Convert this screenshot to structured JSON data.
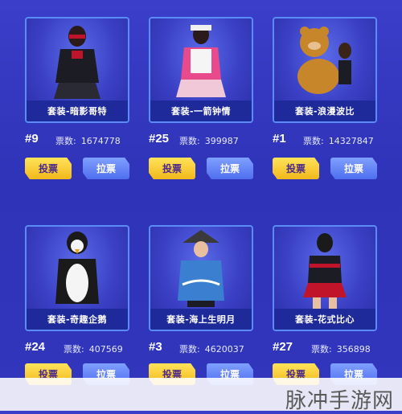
{
  "cards": [
    {
      "name": "套装-暗影哥特",
      "rank": "#9",
      "votes_label": "票数:",
      "votes": "1674778",
      "vote_btn": "投票",
      "pull_btn": "拉票"
    },
    {
      "name": "套装-一箭钟情",
      "rank": "#25",
      "votes_label": "票数:",
      "votes": "399987",
      "vote_btn": "投票",
      "pull_btn": "拉票"
    },
    {
      "name": "套装-浪漫波比",
      "rank": "#1",
      "votes_label": "票数:",
      "votes": "14327847",
      "vote_btn": "投票",
      "pull_btn": "拉票"
    },
    {
      "name": "套装-奇趣企鹅",
      "rank": "#24",
      "votes_label": "票数:",
      "votes": "407569",
      "vote_btn": "投票",
      "pull_btn": "拉票"
    },
    {
      "name": "套装-海上生明月",
      "rank": "#3",
      "votes_label": "票数:",
      "votes": "4620037",
      "vote_btn": "投票",
      "pull_btn": "拉票"
    },
    {
      "name": "套装-花式比心",
      "rank": "#27",
      "votes_label": "票数:",
      "votes": "356898",
      "vote_btn": "投票",
      "pull_btn": "拉票"
    }
  ],
  "watermark": "脉冲手游网",
  "colors": {
    "vote": "#f7c52a",
    "pull": "#5b7cf5",
    "frame": "#5b8cf5",
    "background": "#3438c0"
  }
}
